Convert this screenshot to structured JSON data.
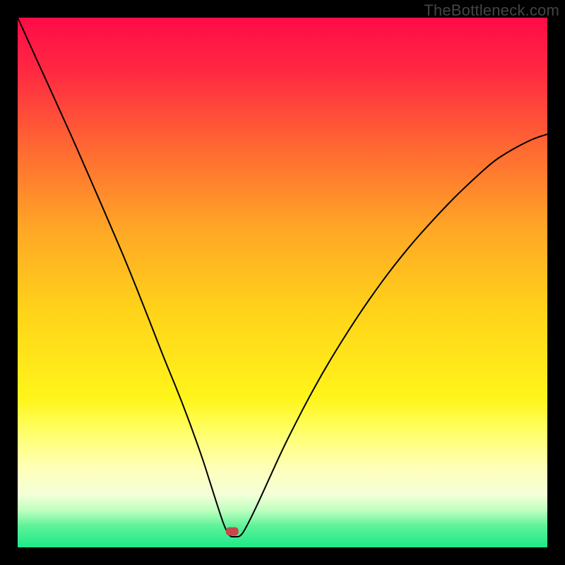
{
  "watermark": "TheBottleneck.com",
  "chart_data": {
    "type": "line",
    "title": "",
    "xlabel": "",
    "ylabel": "",
    "xlim": [
      0,
      100
    ],
    "ylim": [
      0,
      100
    ],
    "grid": false,
    "legend": false,
    "background": {
      "type": "vertical-gradient",
      "stops": [
        {
          "pos": 0.0,
          "color": "#ff0b47"
        },
        {
          "pos": 0.1,
          "color": "#ff2842"
        },
        {
          "pos": 0.25,
          "color": "#ff6a32"
        },
        {
          "pos": 0.4,
          "color": "#ffa726"
        },
        {
          "pos": 0.55,
          "color": "#ffd21a"
        },
        {
          "pos": 0.72,
          "color": "#fff51a"
        },
        {
          "pos": 0.78,
          "color": "#ffff66"
        },
        {
          "pos": 0.85,
          "color": "#ffffb8"
        },
        {
          "pos": 0.9,
          "color": "#f4ffd8"
        },
        {
          "pos": 0.93,
          "color": "#c0ffc0"
        },
        {
          "pos": 0.96,
          "color": "#5cf298"
        },
        {
          "pos": 1.0,
          "color": "#1de98a"
        }
      ]
    },
    "series": [
      {
        "name": "bottleneck-curve",
        "color": "#000000",
        "stroke_width": 2,
        "x": [
          0.0,
          2.5,
          5.0,
          7.5,
          10.0,
          12.5,
          15.0,
          17.5,
          20.0,
          22.5,
          25.0,
          27.5,
          30.0,
          32.5,
          35.0,
          36.5,
          38.0,
          39.0,
          40.0,
          41.0,
          42.0,
          43.0,
          45.0,
          47.5,
          50.0,
          52.5,
          55.0,
          57.5,
          60.0,
          62.5,
          65.0,
          67.5,
          70.0,
          72.5,
          75.0,
          77.5,
          80.0,
          82.5,
          85.0,
          87.5,
          90.0,
          92.5,
          95.0,
          97.5,
          100.0
        ],
        "y": [
          100.0,
          94.5,
          89.0,
          83.5,
          78.0,
          72.3,
          66.6,
          60.8,
          55.0,
          48.8,
          42.5,
          36.0,
          30.0,
          23.5,
          16.5,
          11.7,
          7.0,
          4.0,
          2.0,
          2.0,
          2.0,
          3.5,
          7.5,
          13.0,
          18.5,
          23.5,
          28.3,
          32.8,
          37.0,
          41.0,
          44.8,
          48.4,
          51.8,
          55.0,
          58.0,
          60.8,
          63.5,
          66.1,
          68.5,
          70.8,
          73.0,
          74.6,
          76.0,
          77.2,
          78.0
        ]
      }
    ],
    "marker": {
      "name": "optimal-point",
      "x": 40.5,
      "y": 3.0,
      "shape": "rounded-rect",
      "color": "#c34a4a",
      "width": 2.4,
      "height": 1.6
    }
  }
}
